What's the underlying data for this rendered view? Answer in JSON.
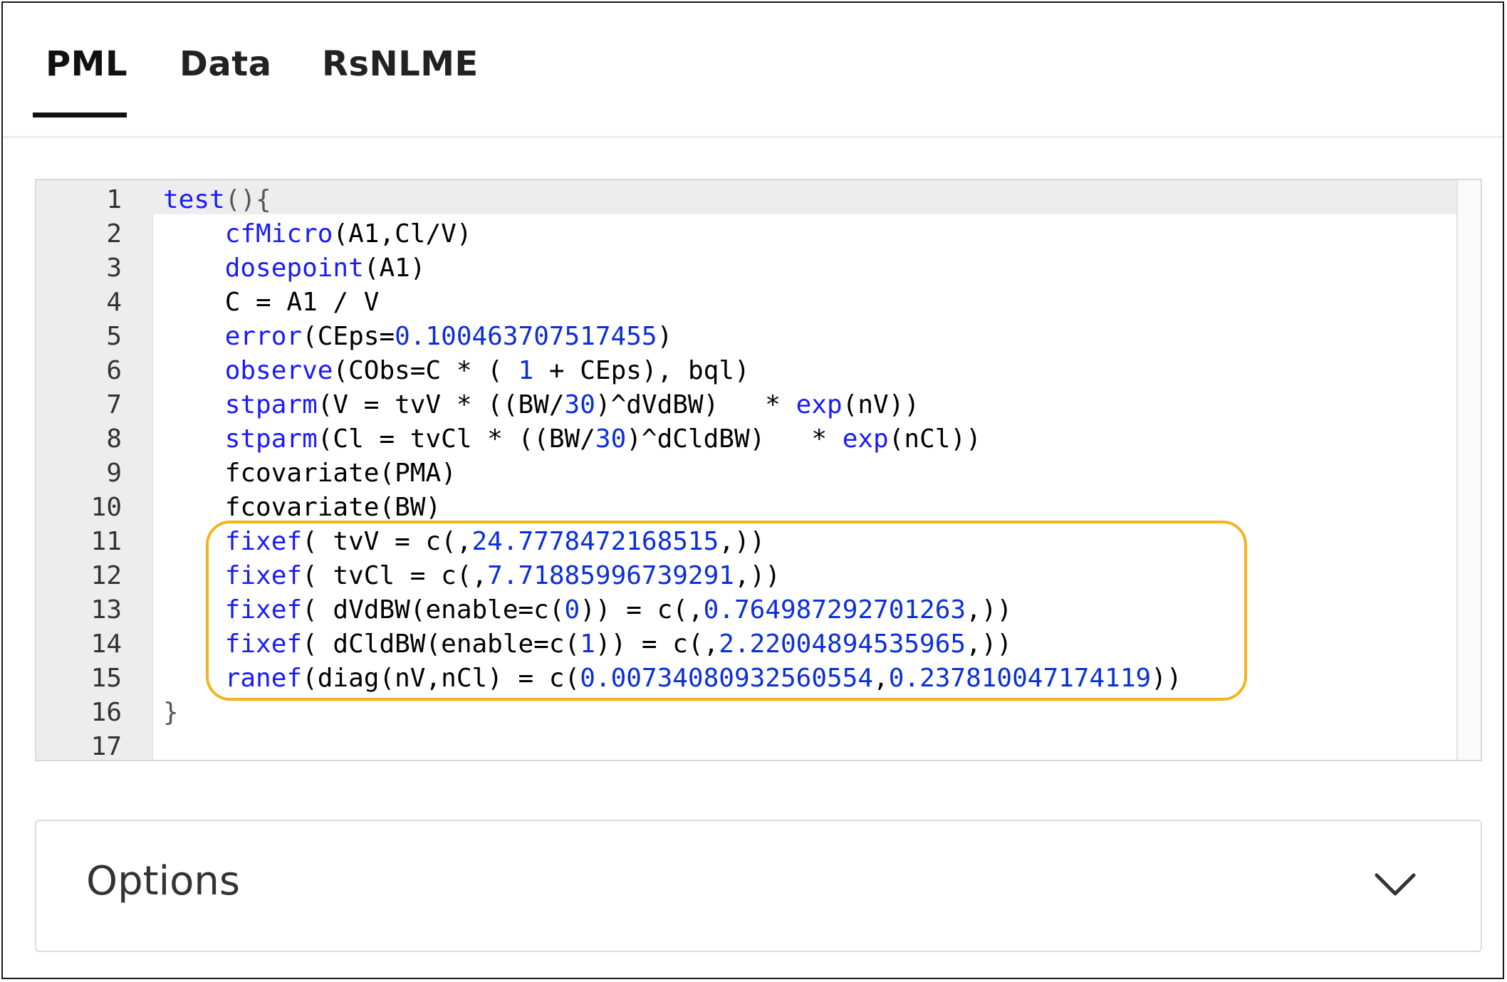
{
  "tabs": [
    {
      "label": "PML",
      "active": true
    },
    {
      "label": "Data",
      "active": false
    },
    {
      "label": "RsNLME",
      "active": false
    }
  ],
  "editor": {
    "lines": [
      {
        "n": "1",
        "segments": [
          {
            "t": "test",
            "c": "kw"
          },
          {
            "t": "(){",
            "c": "op"
          }
        ]
      },
      {
        "n": "2",
        "segments": [
          {
            "t": "    ",
            "c": ""
          },
          {
            "t": "cfMicro",
            "c": "kw"
          },
          {
            "t": "(A1,Cl/V)",
            "c": ""
          }
        ]
      },
      {
        "n": "3",
        "segments": [
          {
            "t": "    ",
            "c": ""
          },
          {
            "t": "dosepoint",
            "c": "kw"
          },
          {
            "t": "(A1)",
            "c": ""
          }
        ]
      },
      {
        "n": "4",
        "segments": [
          {
            "t": "    C = A1 / V",
            "c": ""
          }
        ]
      },
      {
        "n": "5",
        "segments": [
          {
            "t": "    ",
            "c": ""
          },
          {
            "t": "error",
            "c": "kw"
          },
          {
            "t": "(CEps=",
            "c": ""
          },
          {
            "t": "0.100463707517455",
            "c": "num"
          },
          {
            "t": ")",
            "c": ""
          }
        ]
      },
      {
        "n": "6",
        "segments": [
          {
            "t": "    ",
            "c": ""
          },
          {
            "t": "observe",
            "c": "kw"
          },
          {
            "t": "(CObs=C * ( ",
            "c": ""
          },
          {
            "t": "1",
            "c": "num"
          },
          {
            "t": " + CEps), bql)",
            "c": ""
          }
        ]
      },
      {
        "n": "7",
        "segments": [
          {
            "t": "    ",
            "c": ""
          },
          {
            "t": "stparm",
            "c": "kw"
          },
          {
            "t": "(V = tvV * ((BW/",
            "c": ""
          },
          {
            "t": "30",
            "c": "num"
          },
          {
            "t": ")^dVdBW)   * ",
            "c": ""
          },
          {
            "t": "exp",
            "c": "kw"
          },
          {
            "t": "(nV))",
            "c": ""
          }
        ]
      },
      {
        "n": "8",
        "segments": [
          {
            "t": "    ",
            "c": ""
          },
          {
            "t": "stparm",
            "c": "kw"
          },
          {
            "t": "(Cl = tvCl * ((BW/",
            "c": ""
          },
          {
            "t": "30",
            "c": "num"
          },
          {
            "t": ")^dCldBW)   * ",
            "c": ""
          },
          {
            "t": "exp",
            "c": "kw"
          },
          {
            "t": "(nCl))",
            "c": ""
          }
        ]
      },
      {
        "n": "9",
        "segments": [
          {
            "t": "    fcovariate(PMA)",
            "c": ""
          }
        ]
      },
      {
        "n": "10",
        "segments": [
          {
            "t": "    fcovariate(BW)",
            "c": ""
          }
        ]
      },
      {
        "n": "11",
        "segments": [
          {
            "t": "    ",
            "c": ""
          },
          {
            "t": "fixef",
            "c": "kw"
          },
          {
            "t": "( tvV = c(,",
            "c": ""
          },
          {
            "t": "24.7778472168515",
            "c": "num"
          },
          {
            "t": ",))",
            "c": ""
          }
        ]
      },
      {
        "n": "12",
        "segments": [
          {
            "t": "    ",
            "c": ""
          },
          {
            "t": "fixef",
            "c": "kw"
          },
          {
            "t": "( tvCl = c(,",
            "c": ""
          },
          {
            "t": "7.71885996739291",
            "c": "num"
          },
          {
            "t": ",))",
            "c": ""
          }
        ]
      },
      {
        "n": "13",
        "segments": [
          {
            "t": "    ",
            "c": ""
          },
          {
            "t": "fixef",
            "c": "kw"
          },
          {
            "t": "( dVdBW(enable=c(",
            "c": ""
          },
          {
            "t": "0",
            "c": "num"
          },
          {
            "t": ")) = c(,",
            "c": ""
          },
          {
            "t": "0.764987292701263",
            "c": "num"
          },
          {
            "t": ",))",
            "c": ""
          }
        ]
      },
      {
        "n": "14",
        "segments": [
          {
            "t": "    ",
            "c": ""
          },
          {
            "t": "fixef",
            "c": "kw"
          },
          {
            "t": "( dCldBW(enable=c(",
            "c": ""
          },
          {
            "t": "1",
            "c": "num"
          },
          {
            "t": ")) = c(,",
            "c": ""
          },
          {
            "t": "2.22004894535965",
            "c": "num"
          },
          {
            "t": ",))",
            "c": ""
          }
        ]
      },
      {
        "n": "15",
        "segments": [
          {
            "t": "    ",
            "c": ""
          },
          {
            "t": "ranef",
            "c": "kw"
          },
          {
            "t": "(diag(nV,nCl) = c(",
            "c": ""
          },
          {
            "t": "0.00734080932560554",
            "c": "num"
          },
          {
            "t": ",",
            "c": ""
          },
          {
            "t": "0.237810047174119",
            "c": "num"
          },
          {
            "t": "))",
            "c": ""
          }
        ]
      },
      {
        "n": "16",
        "segments": [
          {
            "t": "}",
            "c": "op"
          }
        ]
      },
      {
        "n": "17",
        "segments": []
      }
    ],
    "highlight_color": "#f1b51c"
  },
  "options": {
    "label": "Options",
    "icon": "chevron-down-icon"
  }
}
